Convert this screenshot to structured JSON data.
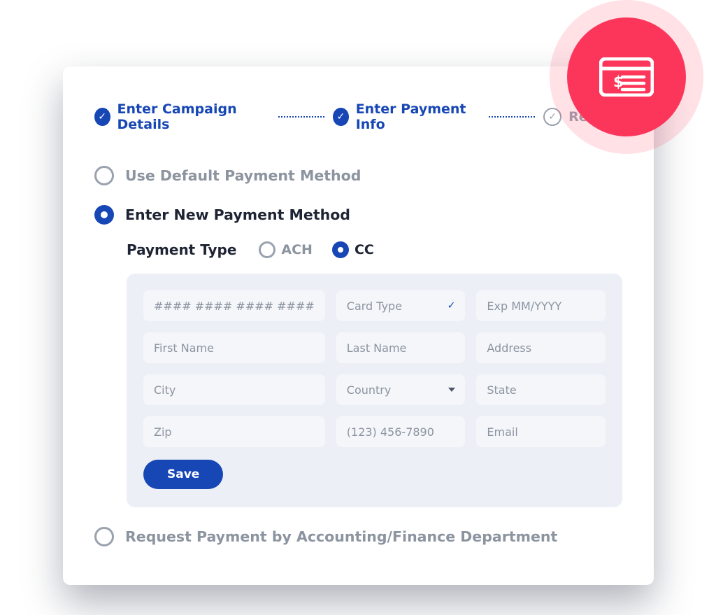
{
  "stepper": {
    "steps": [
      {
        "label": "Enter Campaign Details",
        "status": "done"
      },
      {
        "label": "Enter Payment Info",
        "status": "done"
      },
      {
        "label": "Review",
        "status": "pending"
      }
    ]
  },
  "options": {
    "use_default": "Use Default Payment Method",
    "enter_new": "Enter New Payment Method",
    "request_dept": "Request Payment by Accounting/Finance Department"
  },
  "payment_type": {
    "label": "Payment Type",
    "ach": "ACH",
    "cc": "CC"
  },
  "form": {
    "card_number": "#### #### #### ####",
    "card_type": "Card Type",
    "exp": "Exp MM/YYYY",
    "first_name": "First Name",
    "last_name": "Last Name",
    "address": "Address",
    "city": "City",
    "country": "Country",
    "state": "State",
    "zip": "Zip",
    "phone": "(123) 456-7890",
    "email": "Email",
    "save": "Save"
  }
}
